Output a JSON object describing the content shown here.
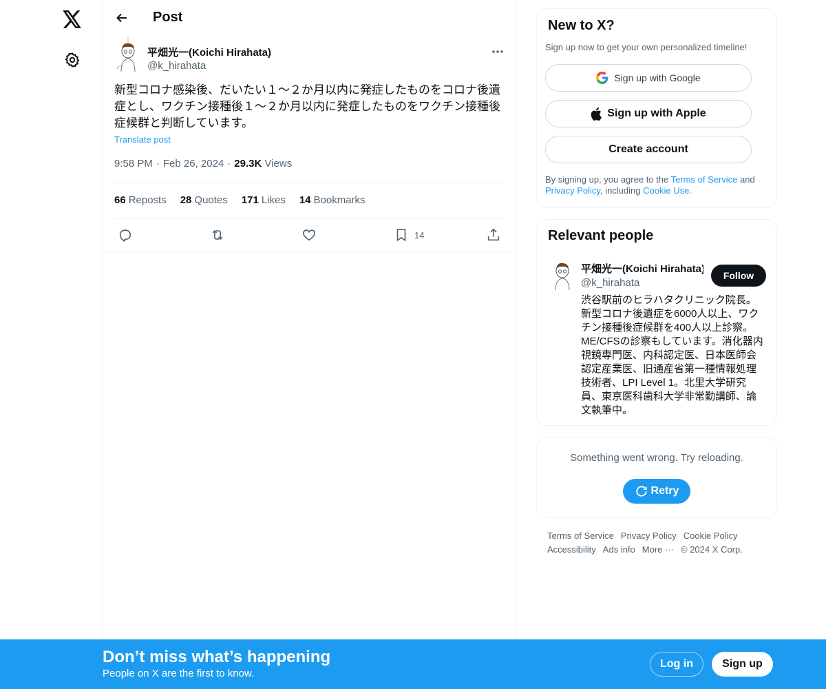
{
  "nav": {
    "logo_icon": "x-logo-icon",
    "settings_icon": "gear-icon"
  },
  "header": {
    "title": "Post"
  },
  "post": {
    "author_name": "平畑光一(Koichi Hirahata)",
    "author_handle": "@k_hirahata",
    "text": "新型コロナ感染後、だいたい１〜２か月以内に発症したものをコロナ後遺症とし、ワクチン接種後１〜２か月以内に発症したものをワクチン接種後症候群と判断しています。",
    "translate_label": "Translate post",
    "time": "9:58 PM",
    "date": "Feb 26, 2024",
    "views_count": "29.3K",
    "views_label": "Views",
    "stats": {
      "reposts_count": "66",
      "reposts_label": "Reposts",
      "quotes_count": "28",
      "quotes_label": "Quotes",
      "likes_count": "171",
      "likes_label": "Likes",
      "bookmarks_count": "14",
      "bookmarks_label": "Bookmarks"
    },
    "actions": {
      "bookmark_count": "14"
    }
  },
  "signup_card": {
    "title": "New to X?",
    "subtitle": "Sign up now to get your own personalized timeline!",
    "google_label": "Sign up with Google",
    "apple_label": "Sign up with Apple",
    "create_label": "Create account",
    "legal_prefix": "By signing up, you agree to the ",
    "terms_link": "Terms of Service",
    "legal_and": " and ",
    "privacy_link": "Privacy Policy",
    "legal_including": ", including ",
    "cookie_link": "Cookie Use."
  },
  "relevant_people": {
    "title": "Relevant people",
    "name": "平畑光一(Koichi Hirahata)",
    "handle": "@k_hirahata",
    "follow_label": "Follow",
    "bio": "渋谷駅前のヒラハタクリニック院長。新型コロナ後遺症を6000人以上、ワクチン接種後症候群を400人以上診察。ME/CFSの診察もしています。消化器内視鏡専門医、内科認定医、日本医師会認定産業医、旧通産省第一種情報処理技術者、LPI Level 1。北里大学研究員、東京医科歯科大学非常勤講師、論文執筆中。"
  },
  "error_card": {
    "message": "Something went wrong. Try reloading.",
    "retry_label": "Retry"
  },
  "footer": {
    "terms": "Terms of Service",
    "privacy": "Privacy Policy",
    "cookie": "Cookie Policy",
    "accessibility": "Accessibility",
    "ads": "Ads info",
    "more": "More ···",
    "copyright": "© 2024 X Corp."
  },
  "bottom_bar": {
    "title": "Don’t miss what’s happening",
    "subtitle": "People on X are the first to know.",
    "login_label": "Log in",
    "signup_label": "Sign up"
  },
  "colors": {
    "accent": "#1d9bf0",
    "text": "#0f1419",
    "secondary": "#536471",
    "border": "#eff3f4"
  }
}
